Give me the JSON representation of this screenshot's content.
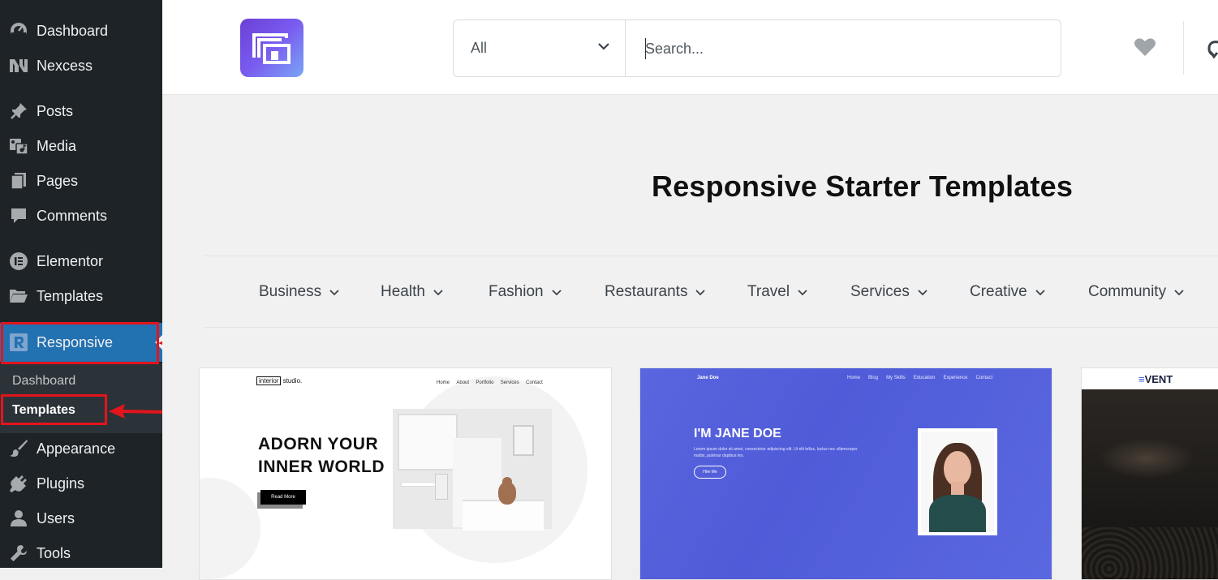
{
  "sidebar": {
    "items": [
      {
        "label": "Dashboard",
        "icon": "dashboard-icon"
      },
      {
        "label": "Nexcess",
        "icon": "nexcess-icon"
      },
      {
        "label": "Posts",
        "icon": "pin-icon"
      },
      {
        "label": "Media",
        "icon": "media-icon"
      },
      {
        "label": "Pages",
        "icon": "pages-icon"
      },
      {
        "label": "Comments",
        "icon": "comment-icon"
      },
      {
        "label": "Elementor",
        "icon": "elementor-icon"
      },
      {
        "label": "Templates",
        "icon": "folder-icon"
      },
      {
        "label": "Responsive",
        "icon": "responsive-r-icon"
      },
      {
        "label": "Appearance",
        "icon": "paintbrush-icon"
      },
      {
        "label": "Plugins",
        "icon": "plug-icon"
      },
      {
        "label": "Users",
        "icon": "user-icon"
      },
      {
        "label": "Tools",
        "icon": "wrench-icon"
      }
    ],
    "submenu": [
      {
        "label": "Dashboard"
      },
      {
        "label": "Templates"
      }
    ]
  },
  "header": {
    "category_selected": "All",
    "search_placeholder": "Search..."
  },
  "main": {
    "title": "Responsive Starter Templates",
    "categories": [
      "Business",
      "Health",
      "Fashion",
      "Restaurants",
      "Travel",
      "Services",
      "Creative",
      "Community"
    ]
  },
  "cards": {
    "interior": {
      "logo": "interior",
      "logo_suffix": "studio.",
      "nav": [
        "Home",
        "About",
        "Portfolio",
        "Services",
        "Contact"
      ],
      "headline_line1": "ADORN YOUR",
      "headline_line2": "INNER WORLD",
      "button": "Read More"
    },
    "jane": {
      "brand": "Jane Doe",
      "nav": [
        "Home",
        "Blog",
        "My Skills",
        "Education",
        "Experience",
        "Contact"
      ],
      "headline": "I'M JANE DOE",
      "body_line1": "Lorem ipsum dolor sit amet, consectetur adipiscing elit. Ut elit tellus, luctus nec ullamcorper",
      "body_line2": "mattis, pulvinar dapibus leo.",
      "button": "Hire Me"
    },
    "event": {
      "logo": "VENT"
    }
  },
  "colors": {
    "sidebar_bg": "#1d2327",
    "active_blue": "#2271b1",
    "highlight_red": "#e3141c",
    "jane_blue": "#5563dc"
  }
}
